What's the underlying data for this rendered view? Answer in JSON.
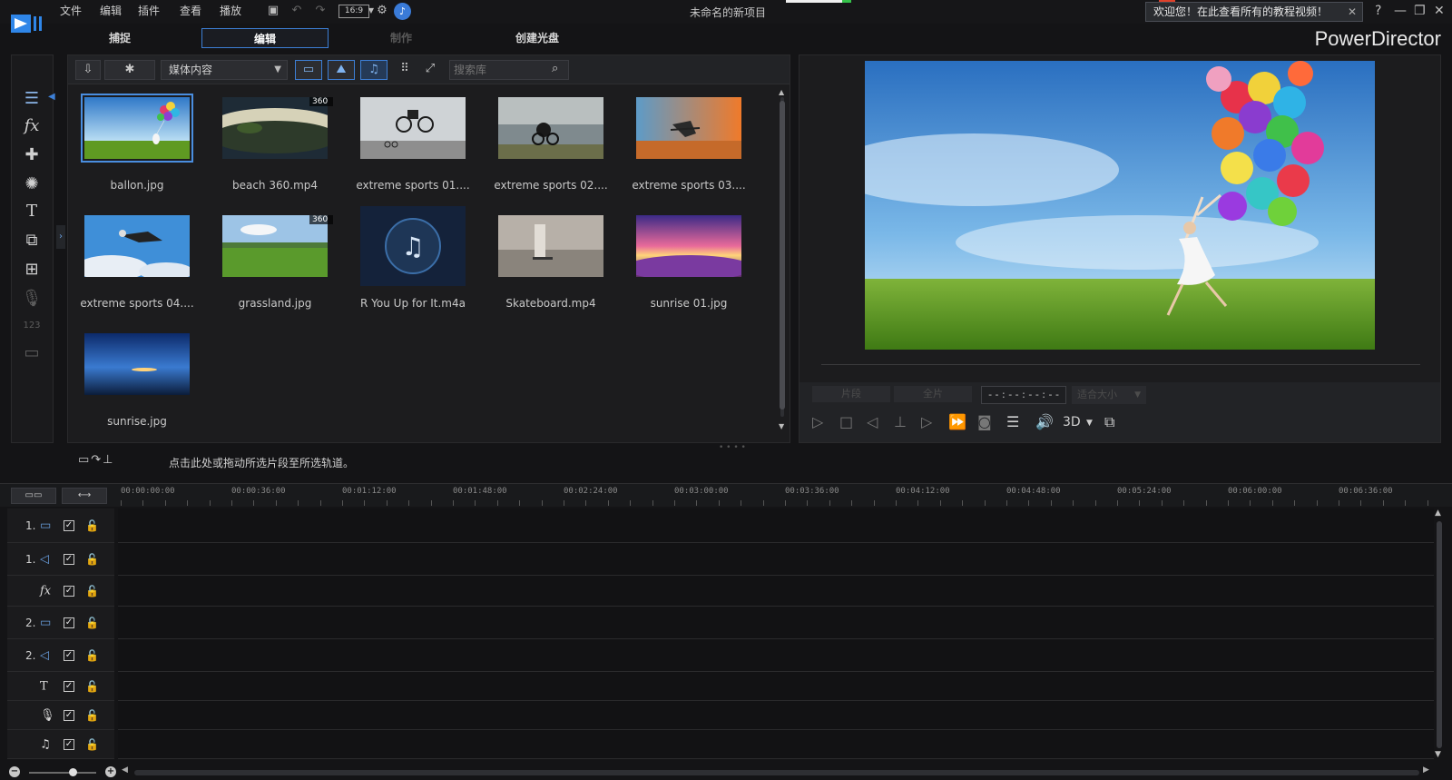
{
  "menu": [
    "文件",
    "编辑",
    "插件",
    "查看",
    "播放"
  ],
  "toolbar": {
    "aspect_ratio": "16:9",
    "project_title": "未命名的新项目",
    "welcome_text": "欢迎您！在此查看所有的教程视频！",
    "help_icon": "?",
    "brand": "PowerDirector"
  },
  "mode_tabs": [
    {
      "label": "捕捉",
      "state": "normal"
    },
    {
      "label": "编辑",
      "state": "active"
    },
    {
      "label": "制作",
      "state": "disabled"
    },
    {
      "label": "创建光盘",
      "state": "normal"
    }
  ],
  "library": {
    "media_select": "媒体内容",
    "search_placeholder": "搜索库",
    "items": [
      {
        "label": "ballon.jpg",
        "selected": true,
        "badge": ""
      },
      {
        "label": "beach 360.mp4",
        "selected": false,
        "badge": "360"
      },
      {
        "label": "extreme sports 01....",
        "selected": false,
        "badge": ""
      },
      {
        "label": "extreme sports 02....",
        "selected": false,
        "badge": ""
      },
      {
        "label": "extreme sports 03....",
        "selected": false,
        "badge": ""
      },
      {
        "label": "extreme sports 04....",
        "selected": false,
        "badge": ""
      },
      {
        "label": "grassland.jpg",
        "selected": false,
        "badge": "360"
      },
      {
        "label": "R You Up for It.m4a",
        "selected": false,
        "badge": ""
      },
      {
        "label": "Skateboard.mp4",
        "selected": false,
        "badge": ""
      },
      {
        "label": "sunrise 01.jpg",
        "selected": false,
        "badge": ""
      },
      {
        "label": "sunrise.jpg",
        "selected": false,
        "badge": ""
      }
    ]
  },
  "preview": {
    "seg_clip": "片段",
    "seg_movie": "全片",
    "timecode": "- - : - - : - - : - -",
    "fit_size": "适合大小",
    "mode_3d": "3D"
  },
  "hint": "点击此处或拖动所选片段至所选轨道。",
  "timeline": {
    "ticks": [
      "00:00:00:00",
      "00:00:36:00",
      "00:01:12:00",
      "00:01:48:00",
      "00:02:24:00",
      "00:03:00:00",
      "00:03:36:00",
      "00:04:12:00",
      "00:04:48:00",
      "00:05:24:00",
      "00:06:00:00",
      "00:06:36:00"
    ],
    "tracks": [
      {
        "num": "1.",
        "icon": "video-track-icon",
        "glyph": "▭"
      },
      {
        "num": "1.",
        "icon": "audio-track-icon",
        "glyph": "◁"
      },
      {
        "num": "",
        "icon": "fx-track-icon",
        "glyph": "fx"
      },
      {
        "num": "2.",
        "icon": "video-track-icon",
        "glyph": "▭"
      },
      {
        "num": "2.",
        "icon": "audio-track-icon",
        "glyph": "◁"
      },
      {
        "num": "",
        "icon": "title-track-icon",
        "glyph": "T"
      },
      {
        "num": "",
        "icon": "voice-track-icon",
        "glyph": "🎙"
      },
      {
        "num": "",
        "icon": "music-track-icon",
        "glyph": "♫"
      }
    ]
  },
  "colors": {
    "accent": "#3d7fd6",
    "bg": "#141416",
    "panel": "#1c1c1e"
  }
}
